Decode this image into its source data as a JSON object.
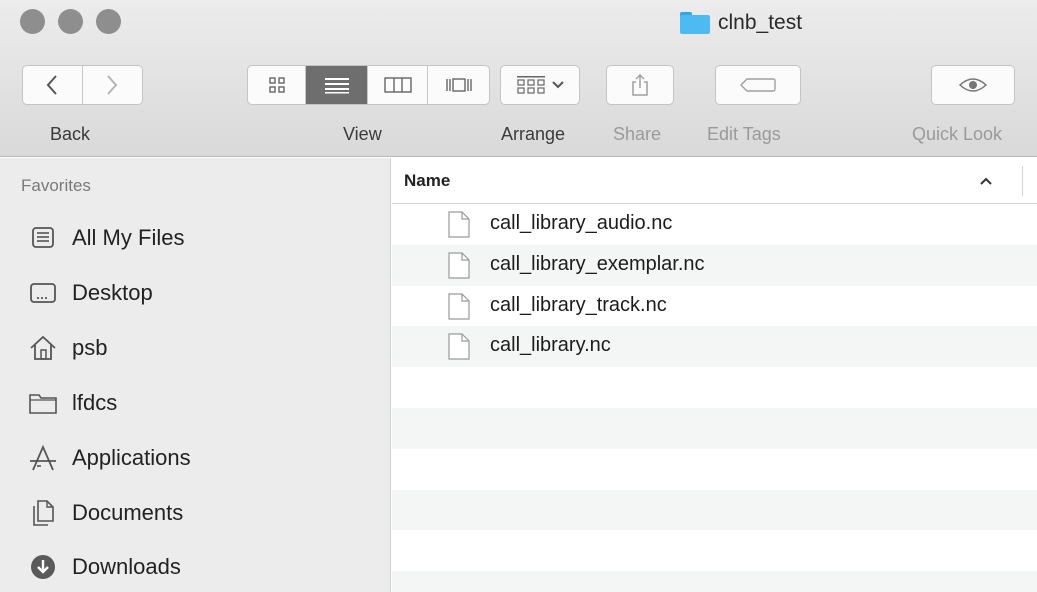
{
  "window": {
    "title": "clnb_test",
    "title_icon": "folder-icon",
    "accent_color": "#4dbaf2"
  },
  "toolbar": {
    "back_label": "Back",
    "view_label": "View",
    "arrange_label": "Arrange",
    "share_label": "Share",
    "edit_tags_label": "Edit Tags",
    "quick_look_label": "Quick Look",
    "active_view": "list"
  },
  "sidebar": {
    "section_title": "Favorites",
    "items": [
      {
        "label": "All My Files",
        "icon": "all-files-icon"
      },
      {
        "label": "Desktop",
        "icon": "desktop-icon"
      },
      {
        "label": "psb",
        "icon": "home-icon"
      },
      {
        "label": "lfdcs",
        "icon": "folder-icon"
      },
      {
        "label": "Applications",
        "icon": "applications-icon"
      },
      {
        "label": "Documents",
        "icon": "documents-icon"
      },
      {
        "label": "Downloads",
        "icon": "downloads-icon"
      }
    ]
  },
  "file_list": {
    "column_name": "Name",
    "sort_direction": "ascending",
    "files": [
      {
        "name": "call_library_audio.nc",
        "icon": "document-icon"
      },
      {
        "name": "call_library_exemplar.nc",
        "icon": "document-icon"
      },
      {
        "name": "call_library_track.nc",
        "icon": "document-icon"
      },
      {
        "name": "call_library.nc",
        "icon": "document-icon"
      }
    ]
  }
}
